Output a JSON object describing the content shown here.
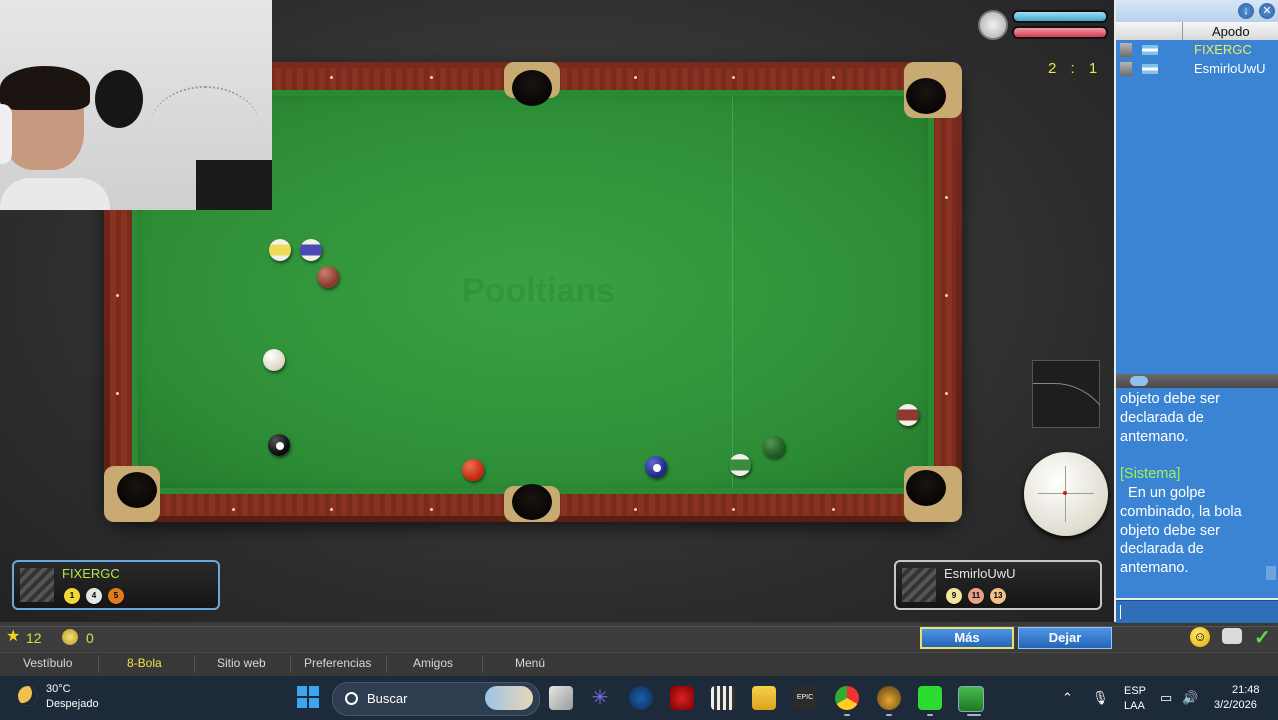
{
  "game": {
    "score": "2 : 1",
    "watermark": "Pooltians",
    "player_left": {
      "name": "FIXERGC",
      "balls": [
        "1",
        "4",
        "5"
      ]
    },
    "player_right": {
      "name": "EsmirloUwU",
      "balls": [
        "9",
        "11",
        "13"
      ]
    },
    "timer_fraction": 1.0,
    "spin_level": 0.0
  },
  "status": {
    "stars": "12",
    "coins": "0"
  },
  "buttons": {
    "more": "Más",
    "leave": "Dejar"
  },
  "nav": {
    "items": [
      "Vestíbulo",
      "8-Bola",
      "Sitio web",
      "Preferencias",
      "Amigos",
      "Menú"
    ],
    "active": "8-Bola"
  },
  "side_panel": {
    "column_header": "Apodo",
    "users": [
      "FIXERGC",
      "EsmirloUwU"
    ],
    "chat_lines": [
      {
        "text": "objeto debe ser",
        "system": false
      },
      {
        "text": "declarada de",
        "system": false
      },
      {
        "text": "antemano.",
        "system": false
      },
      {
        "text": "",
        "system": false
      },
      {
        "text": "[Sistema]",
        "system": true
      },
      {
        "text": "  En un golpe",
        "system": false
      },
      {
        "text": "combinado, la bola",
        "system": false
      },
      {
        "text": "objeto debe ser",
        "system": false
      },
      {
        "text": "declarada de",
        "system": false
      },
      {
        "text": "antemano.",
        "system": false
      }
    ]
  },
  "taskbar": {
    "weather_temp": "30°C",
    "weather_desc": "Despejado",
    "search_placeholder": "Buscar",
    "lang_line1": "ESP",
    "lang_line2": "LAA",
    "time": "21:48",
    "date": "3/2/2026"
  },
  "colors": {
    "cloth": "#2d8d36",
    "rail": "#7a2a1d",
    "player_name_active": "#b8e64a",
    "chat_bg": "#3b84d4",
    "system_chat": "#9ef35a",
    "button_blue": "#2f74c9"
  }
}
